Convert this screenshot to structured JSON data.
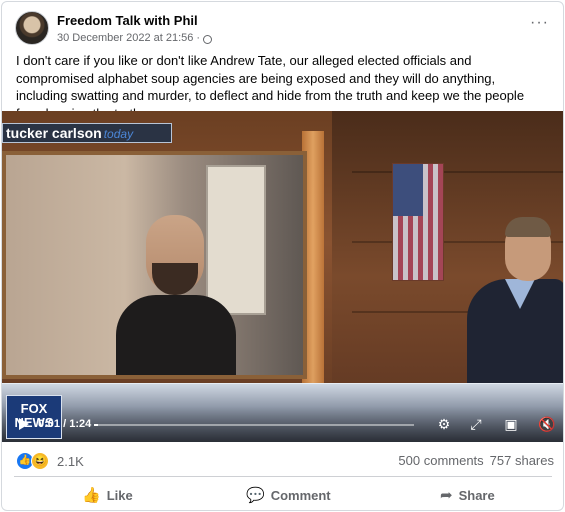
{
  "post": {
    "author": "Freedom Talk with Phil",
    "timestamp": "30 December 2022 at 21:56",
    "timestamp_separator": "·",
    "privacy_icon": "globe-icon",
    "more_icon": "···",
    "text": "I don't care if you like or don't like Andrew Tate, our alleged elected officials and compromised alphabet soup agencies are being exposed and they will do anything, including swatting and murder, to deflect and hide from the truth and keep we the people from hearing the truth."
  },
  "video": {
    "lower_third_name": "tucker carlson",
    "lower_third_tag": "today",
    "network_logo_line1": "FOX",
    "network_logo_line2": "NEWS",
    "current_time": "0:01",
    "duration": "1:24",
    "time_separator": " / ",
    "progress_fraction": 0.012,
    "controls": [
      "settings-icon",
      "fullscreen-icon",
      "pip-icon",
      "volume-muted-icon"
    ]
  },
  "stats": {
    "reaction_count": "2.1K",
    "comments": "500 comments",
    "shares": "757 shares"
  },
  "actions": {
    "like_label": "Like",
    "comment_label": "Comment",
    "share_label": "Share"
  },
  "colors": {
    "facebook_blue": "#1877f2",
    "secondary_text": "#65676b"
  }
}
